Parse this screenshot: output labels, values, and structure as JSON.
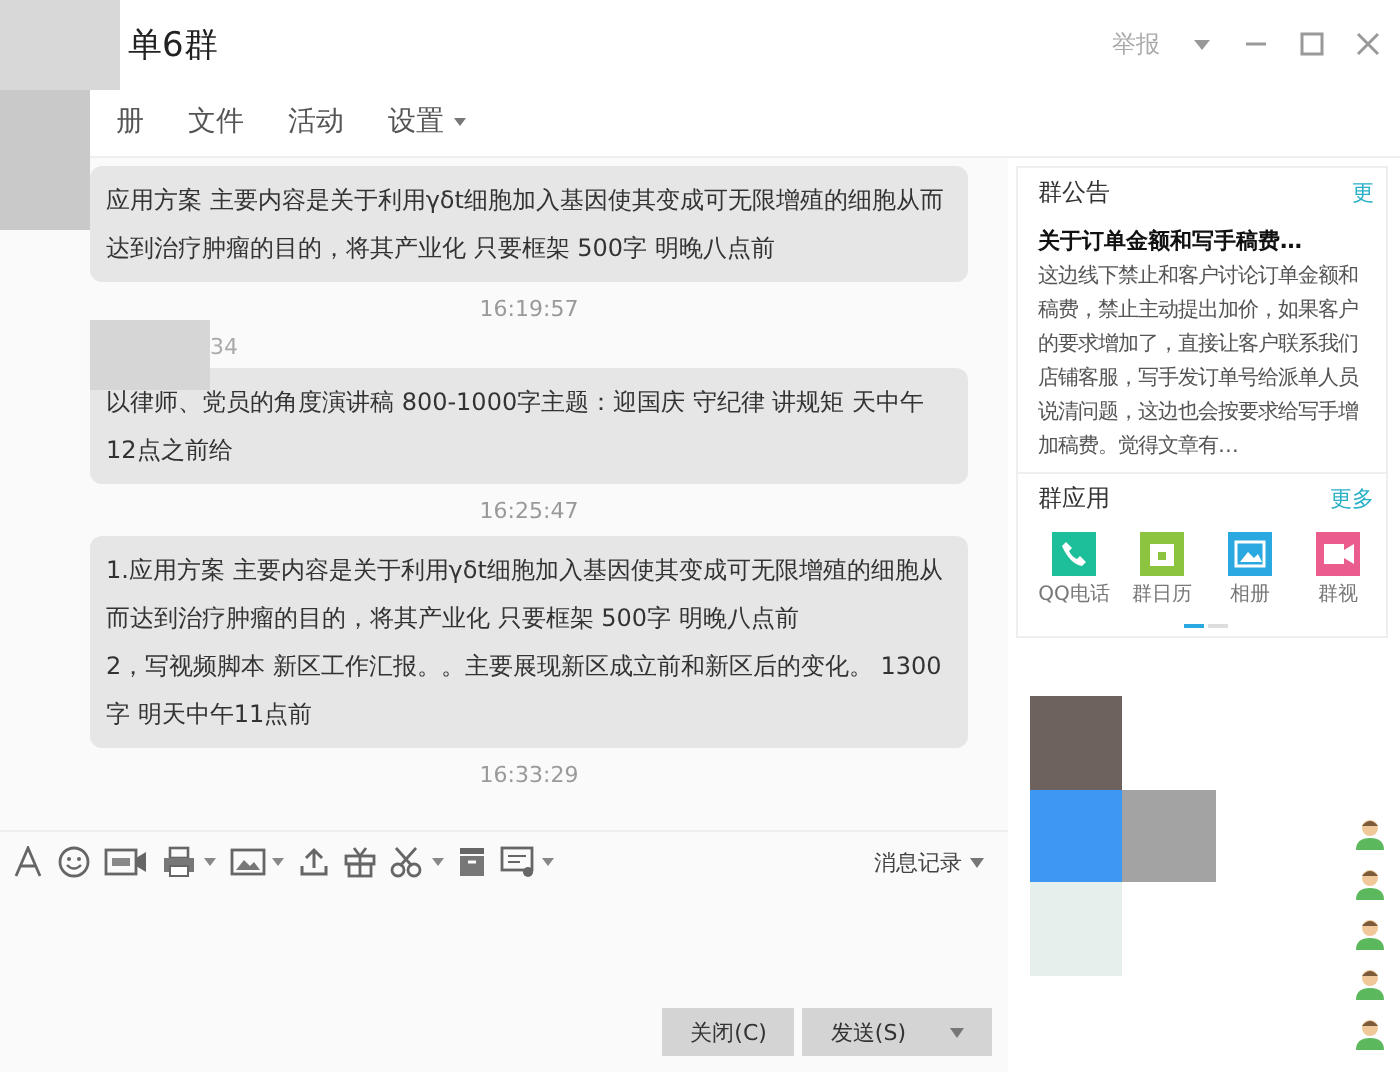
{
  "window": {
    "title": "单6群",
    "report": "举报"
  },
  "tabs": [
    {
      "label": "册",
      "dropdown": false
    },
    {
      "label": "文件",
      "dropdown": false
    },
    {
      "label": "活动",
      "dropdown": false
    },
    {
      "label": "设置",
      "dropdown": true
    }
  ],
  "messages": [
    {
      "kind": "bubble",
      "lines": [
        "应用方案  主要内容是关于利用γδt细胞加入基因使其变成可无限增殖的细胞从而达到治疗肿瘤的目的，将其产业化  只要框架  500字 明晚八点前"
      ]
    },
    {
      "kind": "time",
      "text": "16:19:57"
    },
    {
      "kind": "sender",
      "text": "34"
    },
    {
      "kind": "bubble",
      "lines": [
        "以律师、党员的角度演讲稿  800-1000字主题：迎国庆 守纪律 讲规矩 天中午12点之前给"
      ]
    },
    {
      "kind": "time",
      "text": "16:25:47"
    },
    {
      "kind": "bubble",
      "lines": [
        "1.应用方案  主要内容是关于利用γδt细胞加入基因使其变成可无限增殖的细胞从而达到治疗肿瘤的目的，将其产业化  只要框架  500字 明晚八点前",
        "2，写视频脚本  新区工作汇报。。主要展现新区成立前和新区后的变化。 1300字 明天中午11点前"
      ]
    },
    {
      "kind": "time",
      "text": "16:33:29"
    }
  ],
  "toolbar": [
    {
      "kind": "font",
      "caret": false
    },
    {
      "kind": "emoji",
      "caret": false
    },
    {
      "kind": "gif",
      "caret": false
    },
    {
      "kind": "screenshot",
      "caret": true
    },
    {
      "kind": "image",
      "caret": true
    },
    {
      "kind": "upload",
      "caret": false
    },
    {
      "kind": "gift",
      "caret": false
    },
    {
      "kind": "scissors",
      "caret": true
    },
    {
      "kind": "archive",
      "caret": false
    },
    {
      "kind": "screen",
      "caret": true
    }
  ],
  "history": {
    "label": "消息记录"
  },
  "buttons": [
    {
      "label": "关闭(C)",
      "caret": false
    },
    {
      "label": "发送(S)",
      "caret": true
    }
  ],
  "notice": {
    "title": "群公告",
    "more": "更",
    "heading": "关于订单金额和写手稿费…",
    "body": "这边线下禁止和客户讨论订单金额和稿费，禁止主动提出加价，如果客户的要求增加了，直接让客户联系我们店铺客服，写手发订单号给派单人员说清问题，这边也会按要求给写手增加稿费。觉得文章有…"
  },
  "apps": {
    "title": "群应用",
    "more": "更多",
    "items": [
      {
        "label": "QQ电话",
        "kind": "phone",
        "color": "#1dbf9a"
      },
      {
        "label": "群日历",
        "kind": "calendar",
        "color": "#8cc43f"
      },
      {
        "label": "相册",
        "kind": "photo",
        "color": "#2aa8e0"
      },
      {
        "label": "群视",
        "kind": "video",
        "color": "#e95c8d"
      }
    ],
    "pages": [
      {
        "selected": true
      },
      {
        "selected": false
      }
    ]
  }
}
